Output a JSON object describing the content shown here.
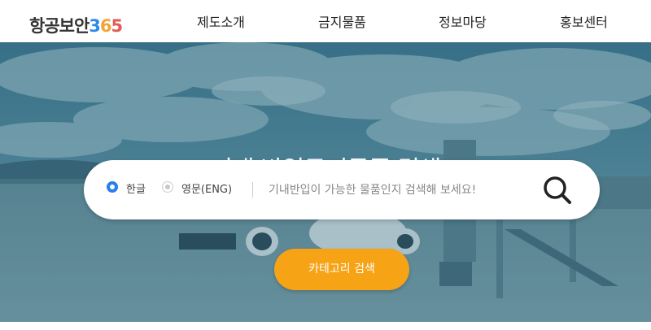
{
  "header": {
    "logo": {
      "korean": "항공보안",
      "digit1": "3",
      "digit2": "6",
      "digit3": "5"
    },
    "nav": [
      {
        "label": "제도소개"
      },
      {
        "label": "금지물품"
      },
      {
        "label": "정보마당"
      },
      {
        "label": "홍보센터"
      }
    ]
  },
  "hero": {
    "title": "기내 반입금지물품 검색",
    "search": {
      "lang_options": [
        {
          "label": "한글",
          "selected": true
        },
        {
          "label": "영문(ENG)",
          "selected": false
        }
      ],
      "placeholder": "기내반입이 가능한 물품인지 검색해 보세요!",
      "search_icon": "search-icon"
    },
    "category_button": {
      "label": "카테고리 검색"
    }
  },
  "colors": {
    "accent_blue": "#2680eb",
    "category_orange": "#f7a316",
    "hero_overlay": "#2f6f86"
  }
}
